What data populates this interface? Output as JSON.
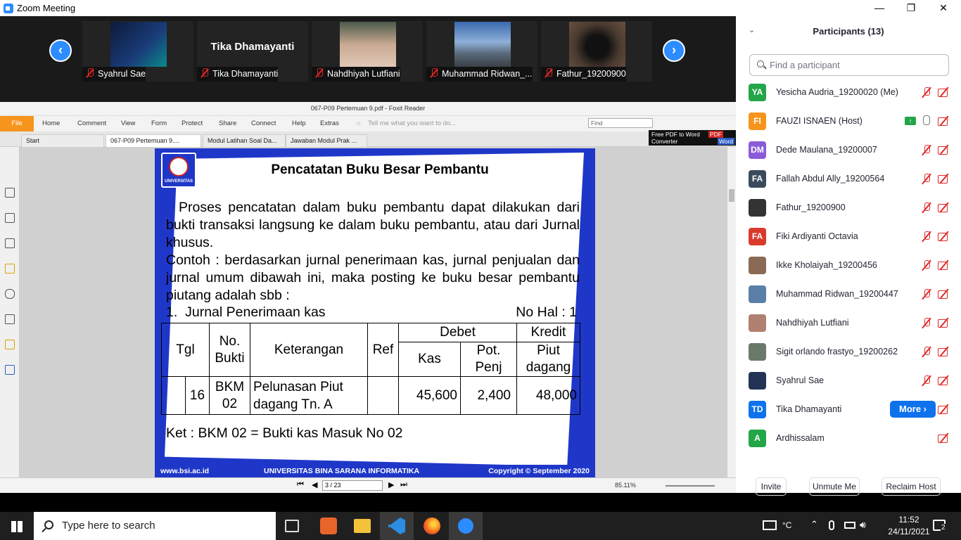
{
  "window": {
    "title": "Zoom Meeting",
    "minimize": "—",
    "restore": "❐",
    "close": "✕"
  },
  "gallery": {
    "prev": "‹",
    "next": "›",
    "tiles": [
      {
        "label": "Syahrul Sae",
        "has_video": true
      },
      {
        "label": "Tika Dhamayanti",
        "display_name": "Tika Dhamayanti",
        "has_video": false
      },
      {
        "label": "Nahdhiyah Lutfiani",
        "has_video": true
      },
      {
        "label": "Muhammad Ridwan_...",
        "has_video": true
      },
      {
        "label": "Fathur_19200900",
        "has_video": true
      }
    ]
  },
  "foxit": {
    "title": "067-P09 Pertemuan 9.pdf - Foxit Reader",
    "file_label": "File",
    "menu": [
      "Home",
      "Comment",
      "View",
      "Form",
      "Protect",
      "Share",
      "Connect",
      "Help",
      "Extras"
    ],
    "tell_me": "Tell me what you want to do...",
    "find_placeholder": "Find",
    "tabs": [
      "Start",
      "067-P09 Pertemuan 9....",
      "Modul Latihan Soal Da...",
      "Jawaban Modul Prak ..."
    ],
    "promo_line1": "Free PDF to Word",
    "promo_line2": "Converter",
    "promo_badge1": "PDF",
    "promo_badge2": "Word",
    "page_field": "3 / 23",
    "zoom": "85.11%"
  },
  "slide": {
    "logo_text": "UNIVERSITAS",
    "title": "Pencatatan Buku Besar Pembantu",
    "para1": "Proses pencatatan dalam buku pembantu dapat dilakukan dari bukti transaksi langsung ke dalam buku pembantu, atau dari Jurnal khusus.",
    "para2": "Contoh : berdasarkan jurnal penerimaan kas, jurnal penjualan dan jurnal umum dibawah ini, maka posting ke buku besar pembantu piutang adalah sbb :",
    "item_num": "1.",
    "item_text": "Jurnal Penerimaan kas",
    "no_hal": "No Hal : 1",
    "table": {
      "h_tgl": "Tgl",
      "h_nobukti": "No. Bukti",
      "h_ket": "Keterangan",
      "h_ref": "Ref",
      "h_debet": "Debet",
      "h_kredit": "Kredit",
      "h_kas": "Kas",
      "h_potpenj": "Pot. Penj",
      "h_piut": "Piut dagang",
      "r_tgl": "16",
      "r_nobukti": "BKM 02",
      "r_ket": "Pelunasan Piut dagang  Tn. A",
      "r_kas": "45,600",
      "r_pot": "2,400",
      "r_piut": "48,000"
    },
    "ket": "Ket : BKM 02 = Bukti kas Masuk No 02",
    "footer_left": "www.bsi.ac.id",
    "footer_mid": "UNIVERSITAS BINA SARANA INFORMATIKA",
    "footer_right": "Copyright © September 2020"
  },
  "participants": {
    "header": "Participants (13)",
    "search_placeholder": "Find a participant",
    "list": [
      {
        "initials": "YA",
        "name": "Yesicha Audria_19200020 (Me)",
        "color": "#23a548"
      },
      {
        "initials": "FI",
        "name": "FAUZI ISNAEN (Host)",
        "color": "#f7941d"
      },
      {
        "initials": "DM",
        "name": "Dede Maulana_19200007",
        "color": "#8c5bd8"
      },
      {
        "initials": "FA",
        "name": "Fallah Abdul Ally_19200564",
        "color": "#3a4a5c"
      },
      {
        "initials": "",
        "name": "Fathur_19200900",
        "color": "#333333"
      },
      {
        "initials": "FA",
        "name": "Fiki Ardiyanti Octavia",
        "color": "#d93a2b"
      },
      {
        "initials": "",
        "name": "Ikke Kholaiyah_19200456",
        "color": "#8a6a55"
      },
      {
        "initials": "",
        "name": "Muhammad Ridwan_19200447",
        "color": "#5a7fa8"
      },
      {
        "initials": "",
        "name": "Nahdhiyah Lutfiani",
        "color": "#b08070"
      },
      {
        "initials": "",
        "name": "Sigit orlando frastyo_19200262",
        "color": "#6a7a6a"
      },
      {
        "initials": "",
        "name": "Syahrul Sae",
        "color": "#223355"
      },
      {
        "initials": "TD",
        "name": "Tika Dhamayanti",
        "color": "#0e72ed"
      },
      {
        "initials": "A",
        "name": "Ardhissalam",
        "color": "#23a548"
      }
    ],
    "more_label": "More",
    "invite": "Invite",
    "unmute_me": "Unmute Me",
    "reclaim_host": "Reclaim Host"
  },
  "taskbar": {
    "search_placeholder": "Type here to search",
    "temp": "°C",
    "time": "11:52",
    "date": "24/11/2021",
    "notif_count": "2"
  }
}
